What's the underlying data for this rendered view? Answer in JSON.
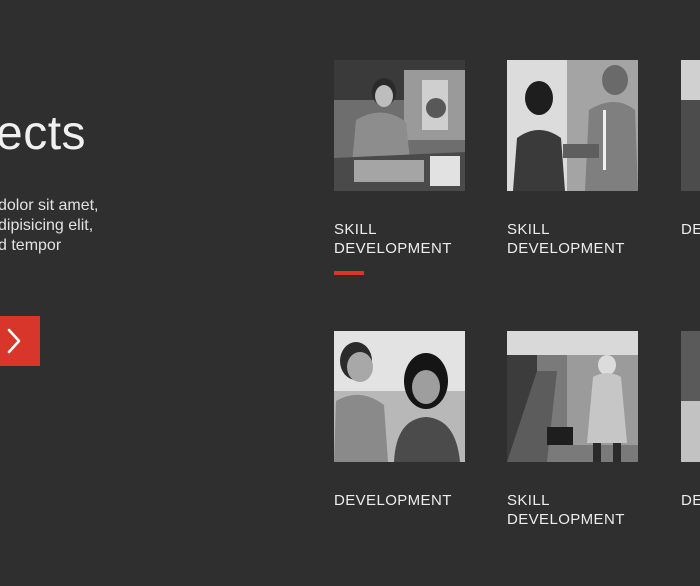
{
  "intro": {
    "title": "ects",
    "body_lines": [
      "dolor sit amet,",
      "dipisicing elit,",
      "d tempor"
    ],
    "cta_icon": "chevron-right-icon",
    "cta_color": "#d9362b"
  },
  "tiles_row1": [
    {
      "image": "photo-man-with-equipment",
      "label_lines": [
        "SKILL",
        "DEVELOPMENT"
      ],
      "active": true
    },
    {
      "image": "photo-two-men-talking",
      "label_lines": [
        "SKILL",
        "DEVELOPMENT"
      ],
      "active": false
    },
    {
      "image": "photo-cropped",
      "label_lines": [
        "DE"
      ],
      "active": false
    }
  ],
  "tiles_row2": [
    {
      "image": "photo-couple-smiling",
      "label_lines": [
        "DEVELOPMENT"
      ],
      "active": false
    },
    {
      "image": "photo-street-walker",
      "label_lines": [
        "SKILL",
        "DEVELOPMENT"
      ],
      "active": false
    },
    {
      "image": "photo-cropped",
      "label_lines": [
        "DE"
      ],
      "active": false
    }
  ],
  "colors": {
    "background": "#2f2f2f",
    "accent": "#d9362b",
    "text": "#ededed"
  }
}
